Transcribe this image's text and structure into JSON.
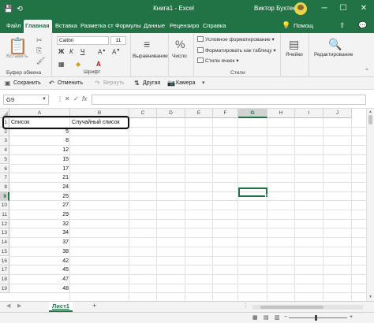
{
  "titlebar": {
    "title": "Книга1 - Excel",
    "user": "Виктор Бухтеев",
    "save_icon": "💾",
    "autosave_icon": "⟲",
    "minimize": "─",
    "maximize": "☐",
    "close": "✕",
    "bg_color": "#217346"
  },
  "tabs": [
    {
      "label": "Файл"
    },
    {
      "label": "Главная"
    },
    {
      "label": "Вставка"
    },
    {
      "label": "Разметка ст"
    },
    {
      "label": "Формулы"
    },
    {
      "label": "Данные"
    },
    {
      "label": "Рецензиро"
    },
    {
      "label": "Справка"
    },
    {
      "label": "Помощ"
    }
  ],
  "ribbon": {
    "clipboard": {
      "paste_label": "Вставить",
      "group_label": "Буфер обмена"
    },
    "font": {
      "font_name": "Calibri",
      "font_size": "11",
      "group_label": "Шрифт",
      "bold": "Ж",
      "italic": "К",
      "underline": "Ч"
    },
    "alignment": {
      "label": "Выравнивание"
    },
    "number": {
      "label": "Число"
    },
    "styles": {
      "conditional": "Условное форматирование",
      "as_table": "Форматировать как таблицу",
      "cell_styles": "Стили ячеек",
      "group_label": "Стили"
    },
    "cells": {
      "label": "Ячейки"
    },
    "editing": {
      "label": "Редактирование"
    }
  },
  "qat": {
    "save": "Сохранить",
    "undo": "Отменить",
    "redo": "Вернуть",
    "other": "Другая",
    "camera": "Камера"
  },
  "formula_bar": {
    "name_box": "G9",
    "cancel": "✕",
    "enter": "✓",
    "fx": "fx",
    "value": ""
  },
  "grid": {
    "columns": [
      "A",
      "B",
      "C",
      "D",
      "E",
      "F",
      "G",
      "H",
      "I",
      "J"
    ],
    "rows": [
      "1",
      "2",
      "3",
      "4",
      "5",
      "6",
      "7",
      "8",
      "9",
      "10",
      "11",
      "12",
      "13",
      "14",
      "15",
      "16",
      "17",
      "18",
      "19"
    ],
    "a1": "Список",
    "b1": "Случайный список",
    "a_values": [
      "5",
      "8",
      "12",
      "15",
      "17",
      "21",
      "24",
      "25",
      "27",
      "29",
      "32",
      "34",
      "37",
      "38",
      "42",
      "45",
      "47",
      "48"
    ],
    "selected_cell": "G9"
  },
  "sheets": {
    "active": "Лист1",
    "add": "+",
    "nav_prev": "◀",
    "nav_next": "▶"
  },
  "statusbar": {
    "zoom_minus": "−",
    "zoom_plus": "+"
  }
}
